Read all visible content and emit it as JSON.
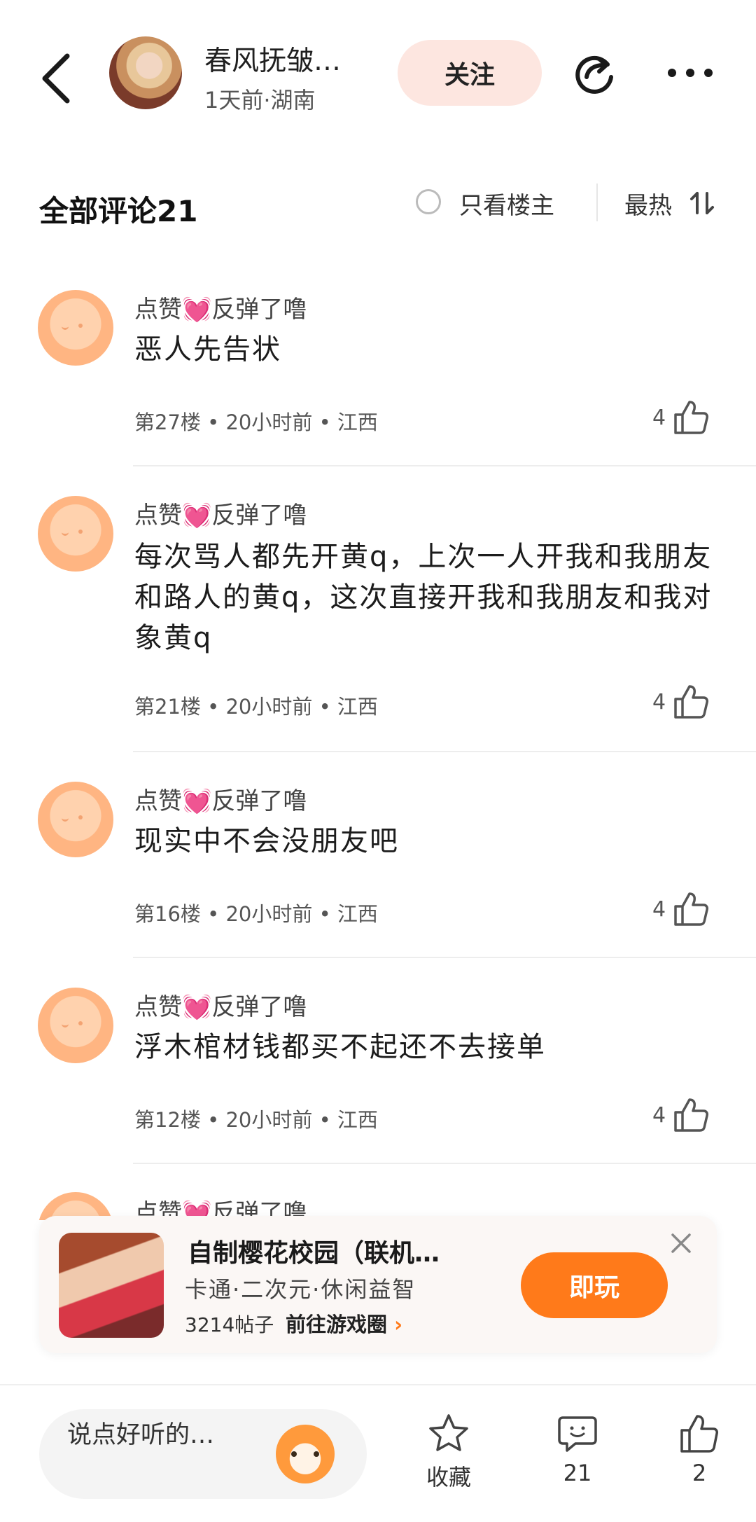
{
  "header": {
    "author_name": "春风抚皱…",
    "author_meta": "1天前·湖南",
    "follow_label": "关注"
  },
  "comments_header": {
    "title": "全部评论21",
    "only_op_label": "只看楼主",
    "sort_label": "最热"
  },
  "comments": [
    {
      "user": "点赞",
      "user_suffix": "反弹了噜",
      "text": "恶人先告状",
      "meta": "第27楼 • 20小时前 • 江西",
      "likes": "4"
    },
    {
      "user": "点赞",
      "user_suffix": "反弹了噜",
      "text": "每次骂人都先开黄q，上次一人开我和我朋友和路人的黄q，这次直接开我和我朋友和我对象黄q",
      "meta": "第21楼 • 20小时前 • 江西",
      "likes": "4"
    },
    {
      "user": "点赞",
      "user_suffix": "反弹了噜",
      "text": "现实中不会没朋友吧",
      "meta": "第16楼 • 20小时前 • 江西",
      "likes": "4"
    },
    {
      "user": "点赞",
      "user_suffix": "反弹了噜",
      "text": "浮木棺材钱都买不起还不去接单",
      "meta": "第12楼 • 20小时前 • 江西",
      "likes": "4"
    }
  ],
  "partial_comment": {
    "user": "点赞",
    "user_suffix": "反弹了噜"
  },
  "heart_glyph": "💓",
  "game_card": {
    "title": "自制樱花校园（联机…",
    "tags": "卡通·二次元·休闲益智",
    "posts": "3214帖子",
    "link_label": "前往游戏圈",
    "play_label": "即玩"
  },
  "bottom_bar": {
    "input_placeholder": "说点好听的…",
    "favorite_label": "收藏",
    "comment_count": "21",
    "like_count": "2"
  },
  "colors": {
    "accent_orange": "#ff7a1a",
    "follow_bg": "#fde6e0"
  }
}
